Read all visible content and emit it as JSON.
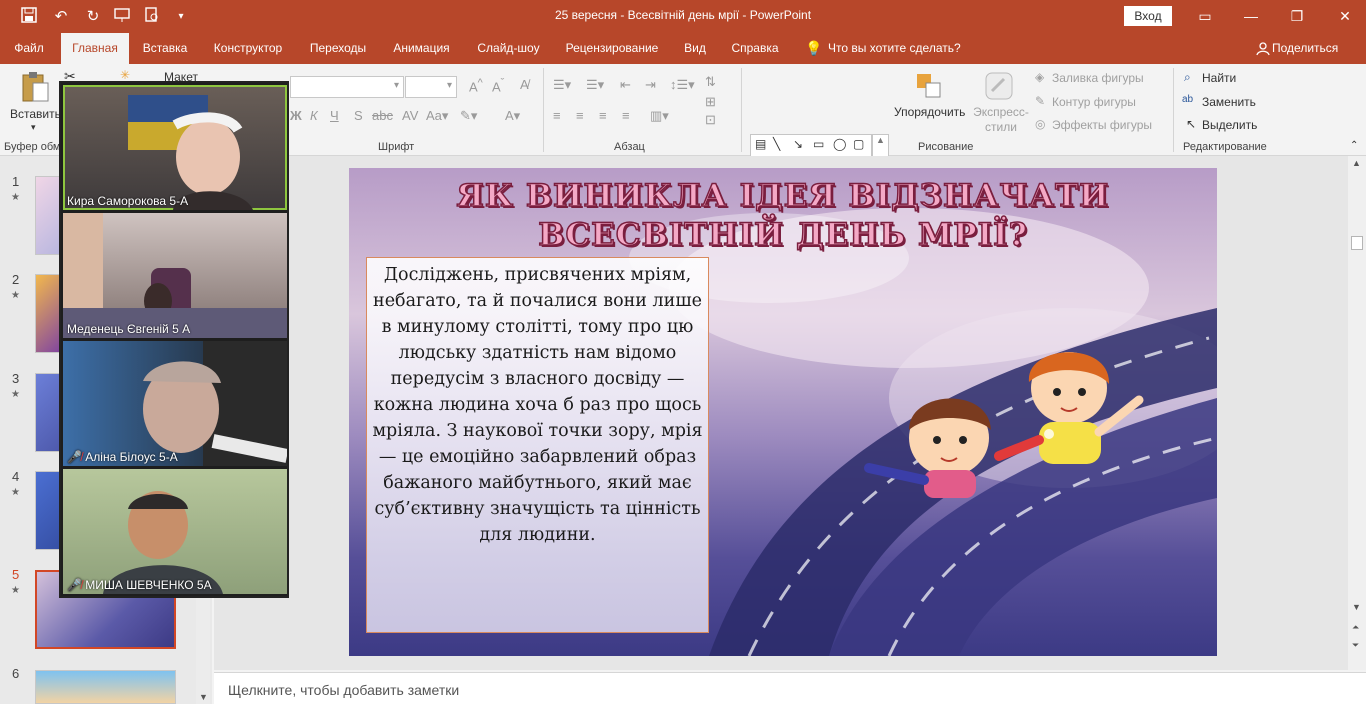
{
  "window": {
    "title": "25 вересня - Всесвітній день мрії  -  PowerPoint",
    "login_label": "Вход"
  },
  "quick_access": [
    "save-icon",
    "undo-icon",
    "redo-icon",
    "present-icon",
    "preview-icon",
    "customize-icon"
  ],
  "tabs": [
    {
      "label": "Файл"
    },
    {
      "label": "Главная"
    },
    {
      "label": "Вставка"
    },
    {
      "label": "Конструктор"
    },
    {
      "label": "Переходы"
    },
    {
      "label": "Анимация"
    },
    {
      "label": "Слайд-шоу"
    },
    {
      "label": "Рецензирование"
    },
    {
      "label": "Вид"
    },
    {
      "label": "Справка"
    },
    {
      "label": "Что вы хотите сделать?"
    }
  ],
  "active_tab": "Главная",
  "share_label": "Поделиться",
  "ribbon": {
    "paste_label": "Вставить",
    "clipboard_label": "Буфер обм",
    "layout_label": "Макет",
    "font_group_label": "Шрифт",
    "paragraph_group_label": "Абзац",
    "drawing_group_label": "Рисование",
    "editing_group_label": "Редактирование",
    "arrange_label": "Упорядочить",
    "quick_styles_label": "Экспресс-стили",
    "shape_fill_label": "Заливка фигуры",
    "shape_outline_label": "Контур фигуры",
    "shape_effects_label": "Эффекты фигуры",
    "find_label": "Найти",
    "replace_label": "Заменить",
    "select_label": "Выделить"
  },
  "thumbnails": [
    {
      "num": "1"
    },
    {
      "num": "2"
    },
    {
      "num": "3"
    },
    {
      "num": "4"
    },
    {
      "num": "5"
    },
    {
      "num": "6"
    }
  ],
  "selected_slide": "5",
  "slide": {
    "title_line1": "ЯК ВИНИКЛА ІДЕЯ ВІДЗНАЧАТИ",
    "title_line2": "ВСЕСВІТНІЙ ДЕНЬ МРІЇ?",
    "body": "Досліджень, присвячених мріям, небагато, та й почалися вони лише в минулому столітті,  тому  про цю людську здатність нам відомо передусім з власного досвіду — кожна людина хоча б раз про щось мріяла. З наукової точки зору, мрія — це емоційно забарвлений образ бажаного майбутнього, який має суб’єктивну значущість та цінність для людини."
  },
  "notes_placeholder": "Щелкните, чтобы добавить заметки",
  "participants": [
    {
      "name": "Кира Саморокова 5-А",
      "muted": false,
      "active": true
    },
    {
      "name": "Меденець Євгеній 5 А",
      "muted": false,
      "active": false
    },
    {
      "name": "Аліна Білоус 5-А",
      "muted": true,
      "active": false
    },
    {
      "name": "МИША ШЕВЧЕНКО 5А",
      "muted": true,
      "active": false
    }
  ],
  "colors": {
    "accent": "#b7472a",
    "selection": "#d24726"
  }
}
